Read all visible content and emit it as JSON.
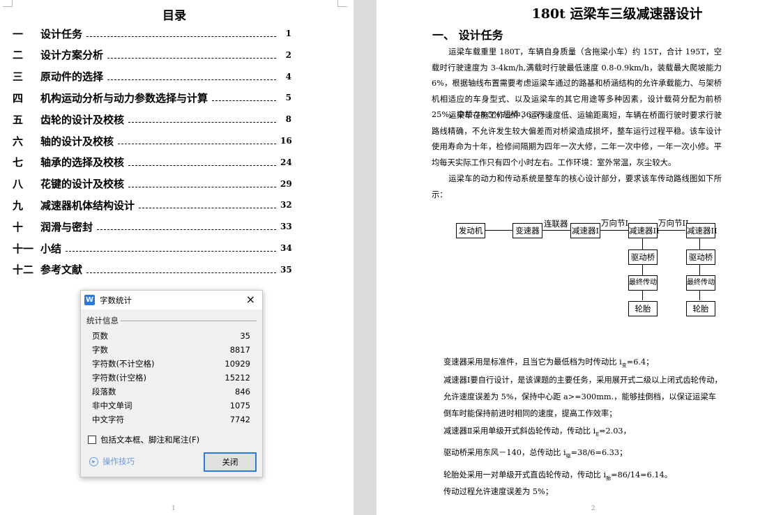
{
  "toc": {
    "title": "目录",
    "items": [
      {
        "num": "一",
        "label": "设计任务",
        "page": "1"
      },
      {
        "num": "二",
        "label": "设计方案分析",
        "page": "2"
      },
      {
        "num": "三",
        "label": "原动件的选择",
        "page": "4"
      },
      {
        "num": "四",
        "label": "机构运动分析与动力参数选择与计算",
        "page": "5"
      },
      {
        "num": "五",
        "label": "齿轮的设计及校核",
        "page": "8"
      },
      {
        "num": "六",
        "label": "轴的设计及校核",
        "page": "16"
      },
      {
        "num": "七",
        "label": "轴承的选择及校核",
        "page": "24"
      },
      {
        "num": "八",
        "label": "花键的设计及校核",
        "page": "29"
      },
      {
        "num": "九",
        "label": "减速器机体结构设计",
        "page": "32"
      },
      {
        "num": "十",
        "label": "润滑与密封",
        "page": "33"
      },
      {
        "num": "十一",
        "label": "小结",
        "page": "34"
      },
      {
        "num": "十二",
        "label": "参考文献",
        "page": "35"
      }
    ]
  },
  "page1_number": "1",
  "page2_number": "2",
  "doc": {
    "title": "180t 运梁车三级减速器设计",
    "heading": "一、  设计任务",
    "p1": "运梁车载重里 180T，车辆自身质量（含拖梁小车）约 15T，合计 195T，空载时行驶速度为 3-4km/h,满载时行驶最低速度 0.8-0.9km/h，装载最大爬坡能力 6%，根据轴线布置需要考虑运梁车通过的路基和桥涵结构的允许承载能力、与架桥机相适应的车身型式、以及运梁车的其它用途等多种因素，设计载荷分配为前桥 25%，中桥 38.5%,后桥 36.5% 。",
    "p2": "运梁车在施工作业中，运行速度低、运输距离短，车辆在桥面行驶时要求行驶路线精确，不允许发生较大偏差而对桥梁造成损坏，整车运行过程平稳。该车设计使用寿命为十年，检修间隔期为四年一次大修，二年一次中修，一年一次小修。平均每天实际工作只有四个小时左右。工作环境：室外常温，灰尘较大。",
    "p3": "运梁车的动力和传动系统是整车的核心设计部分，要求该车传动路线图如下所示：",
    "b1": "变速器采用是标准件，且当它为最低档为时传动比 i",
    "b1_sub": "变",
    "b1_end": "=6.4；",
    "b2": "减速器Ⅰ要自行设计，是该课题的主要任务，采用展开式二级以上闭式齿轮传动，允许速度误差为 5%，保持中心距 a>=300mm.，能够挂倒档，以保证运梁车倒车时能保持前进时相同的速度，提高工作效率；",
    "b3": "减速器Ⅱ采用单级开式斜齿轮传动，传动比 i",
    "b3_sub": "Ⅱ",
    "b3_end": "=2.03，",
    "b4": "驱动桥采用东风－140，总传动比 i",
    "b4_sub": "驱",
    "b4_end": "=38/6=6.33；",
    "b5": "轮胎处采用一对单级开式直齿轮传动，传动比 i",
    "b5_sub": "胎",
    "b5_end": "=86/14=6.14。",
    "b6": "传动过程允许速度误差为 5%；"
  },
  "diagram": {
    "engine": "发动机",
    "gearbox": "变速器",
    "coupling": "连联器",
    "reducer1": "减速器Ⅰ",
    "ujoint1": "万向节Ⅰ",
    "reducer2a": "减速器II",
    "ujoint2": "万向节II",
    "reducer2b": "减速器II",
    "axle": "驱动桥",
    "final": "最终传动",
    "tire": "轮胎"
  },
  "dialog": {
    "title": "字数统计",
    "group": "统计信息",
    "stats": [
      {
        "label": "页数",
        "value": "35"
      },
      {
        "label": "字数",
        "value": "8817"
      },
      {
        "label": "字符数(不计空格)",
        "value": "10929"
      },
      {
        "label": "字符数(计空格)",
        "value": "15212"
      },
      {
        "label": "段落数",
        "value": "846"
      },
      {
        "label": "非中文单词",
        "value": "1075"
      },
      {
        "label": "中文字符",
        "value": "7742"
      }
    ],
    "checkbox": "包括文本框、脚注和尾注(F)",
    "checked": false,
    "tips": "操作技巧",
    "close": "关闭",
    "close_icon": "×",
    "logo": "W"
  }
}
